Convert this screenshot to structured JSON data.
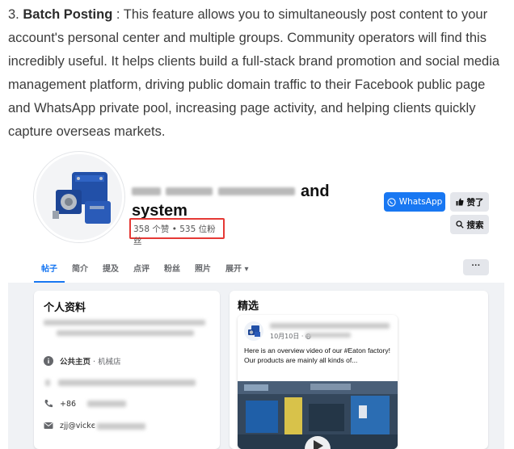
{
  "intro": {
    "number": "3.",
    "heading": "Batch Posting",
    "text": " : This feature allows you to simultaneously post content to your account's personal center and multiple groups. Community operators will find this incredibly useful. It helps clients build a full-stack brand promotion and social media management platform, driving public domain traffic to their Facebook public page and WhatsApp private pool, increasing page activity, and helping clients quickly capture overseas markets."
  },
  "page": {
    "name_visible_1": "and",
    "name_visible_2": "system",
    "stats": "358 个赞 • 535 位粉丝",
    "whatsapp_button": "WhatsApp",
    "like_button": "赞了",
    "search_button": "搜索",
    "more_button": "···"
  },
  "tabs": [
    {
      "label": "帖子",
      "active": true
    },
    {
      "label": "简介"
    },
    {
      "label": "提及"
    },
    {
      "label": "点评"
    },
    {
      "label": "粉丝"
    },
    {
      "label": "照片"
    },
    {
      "label": "展开 ▾"
    }
  ],
  "about": {
    "title": "个人资料",
    "category_label": "公共主页",
    "category_value": " · 机械店",
    "phone": "+86",
    "email": "zjj@vickє"
  },
  "featured": {
    "title": "精选",
    "post_date": "10月10日 · ",
    "post_text_1": "Here is an overview video of our #Eaton factory!",
    "post_text_2": "Our products are mainly all kinds of..."
  },
  "colors": {
    "facebook_blue": "#1877f2",
    "highlight_red": "#e53935",
    "feed_bg": "#f0f2f5"
  }
}
